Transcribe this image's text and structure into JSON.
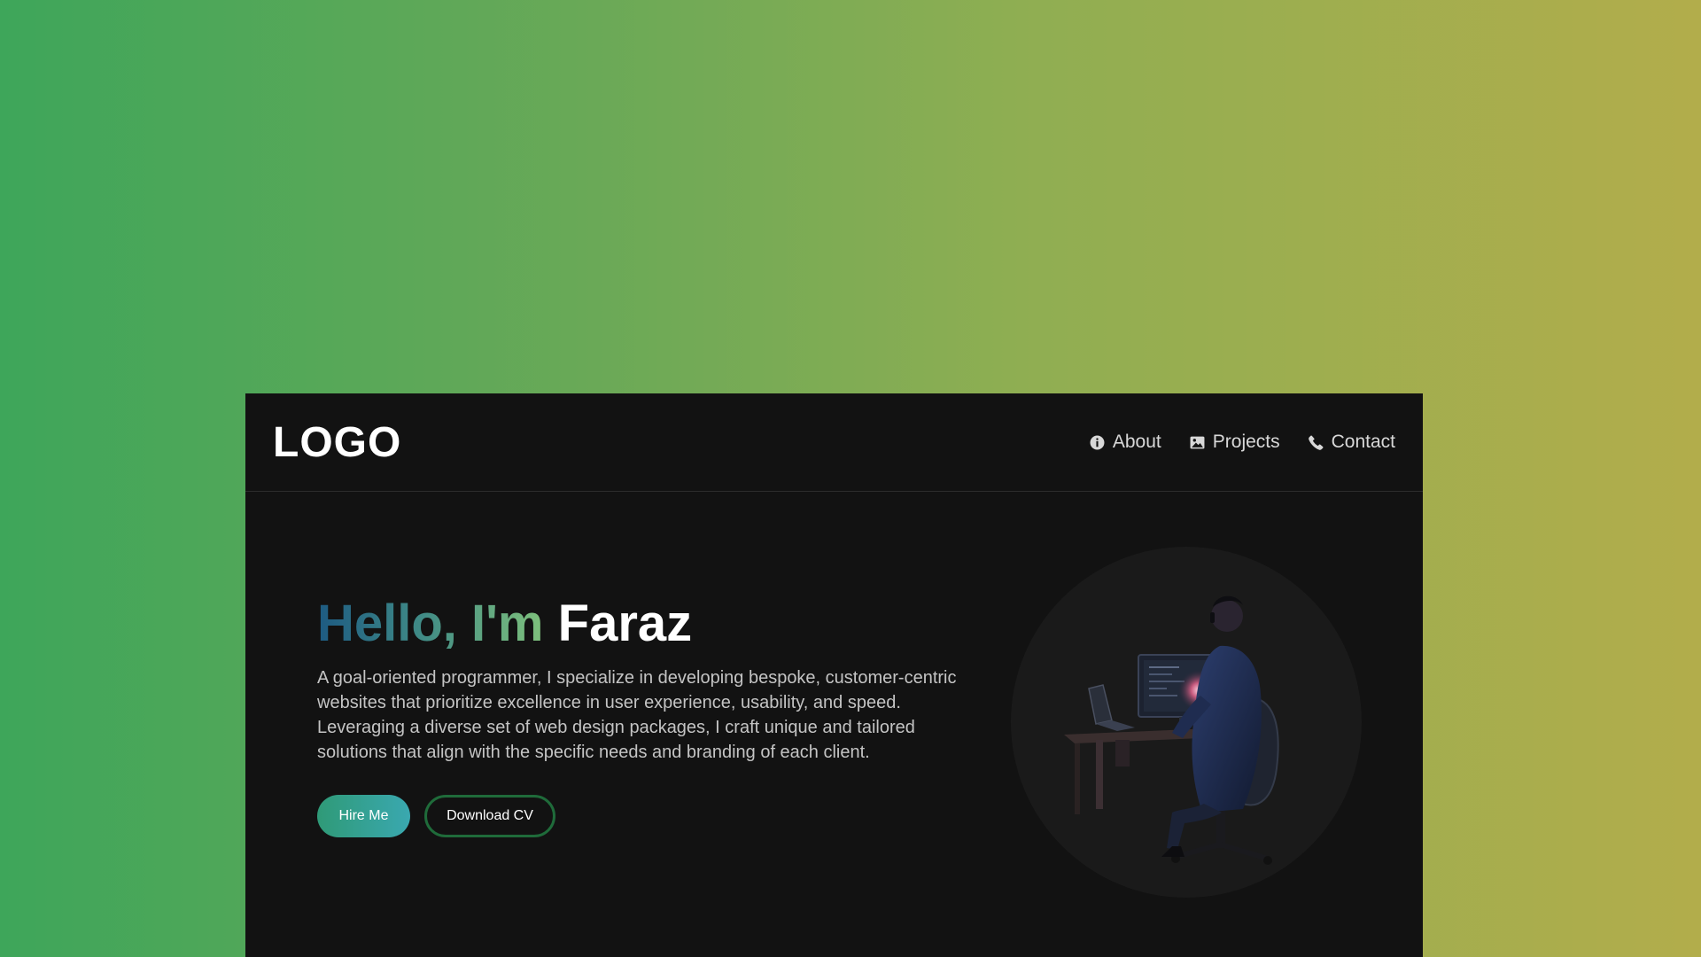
{
  "header": {
    "logo": "LOGO",
    "nav": [
      {
        "label": "About",
        "icon": "info-icon"
      },
      {
        "label": "Projects",
        "icon": "image-icon"
      },
      {
        "label": "Contact",
        "icon": "phone-icon"
      }
    ]
  },
  "hero": {
    "greeting": "Hello, I'm",
    "name": "Faraz",
    "description": "A goal-oriented programmer, I specialize in developing bespoke, customer-centric websites that prioritize excellence in user experience, usability, and speed. Leveraging a diverse set of web design packages, I craft unique and tailored solutions that align with the specific needs and branding of each client.",
    "hire_label": "Hire Me",
    "cv_label": "Download CV"
  },
  "colors": {
    "background_gradient": [
      "#3ea65a",
      "#b2ad4b"
    ],
    "window_bg": "#121212",
    "greeting_gradient": [
      "#1d5a82",
      "#7ec07c"
    ],
    "primary_button": [
      "#2f9a77",
      "#3aa8b0"
    ],
    "outline_border": "#1f6b3a"
  }
}
